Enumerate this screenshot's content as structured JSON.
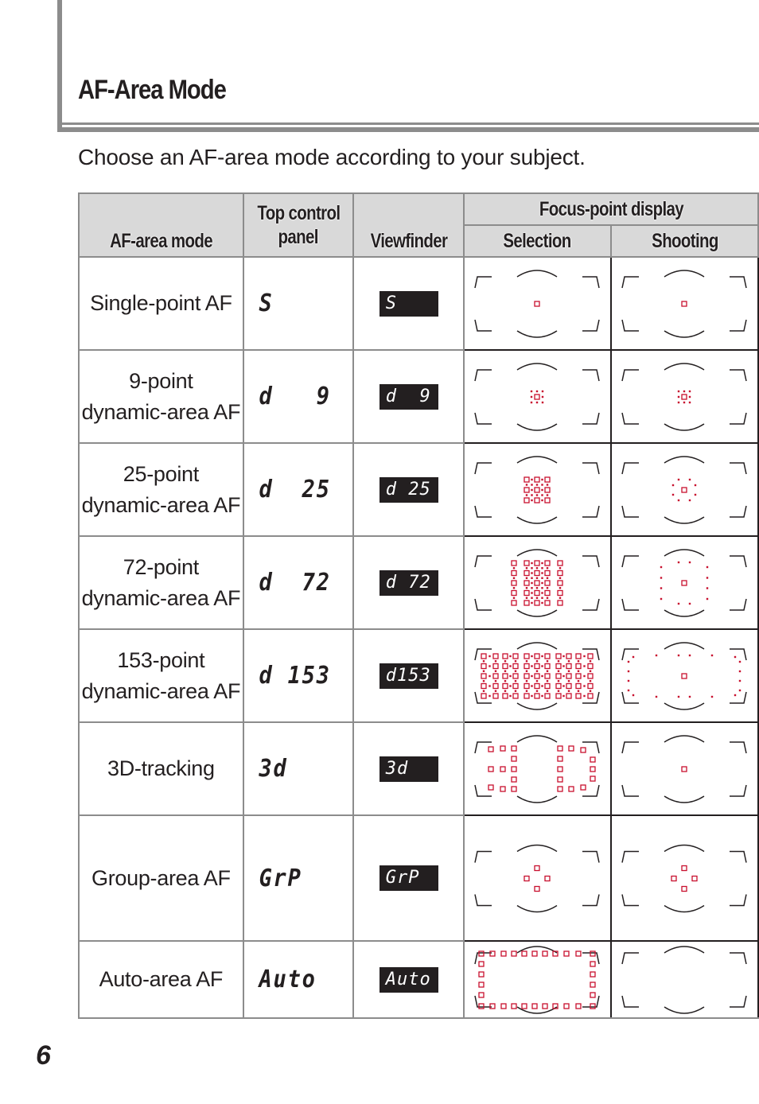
{
  "page": {
    "title": "AF-Area Mode",
    "intro": "Choose an AF-area mode according to your subject.",
    "page_number": "6"
  },
  "colors": {
    "focus_point": "#c8102e",
    "frame_line": "#231f20",
    "header_bg": "#d9d9d9",
    "rule": "#8c8c8c",
    "lcd_bg": "#231f20"
  },
  "table": {
    "headers": {
      "mode": "AF-area mode",
      "top_panel_line1": "Top control",
      "top_panel_line2": "panel",
      "viewfinder": "Viewfinder",
      "focus_group": "Focus-point display",
      "selection": "Selection",
      "shooting": "Shooting"
    },
    "rows": [
      {
        "mode_line1": "Single-point AF",
        "mode_line2": "",
        "top_panel": "S",
        "viewfinder": "S",
        "selection_pattern": "single",
        "shooting_pattern": "single"
      },
      {
        "mode_line1": "9-point",
        "mode_line2": "dynamic-area AF",
        "top_panel": "d   9",
        "viewfinder": "d  9",
        "selection_pattern": "d9",
        "shooting_pattern": "d9"
      },
      {
        "mode_line1": "25-point",
        "mode_line2": "dynamic-area AF",
        "top_panel": "d  25",
        "viewfinder": "d 25",
        "selection_pattern": "d25",
        "shooting_pattern": "d25-shoot"
      },
      {
        "mode_line1": "72-point",
        "mode_line2": "dynamic-area AF",
        "top_panel": "d  72",
        "viewfinder": "d 72",
        "selection_pattern": "d72",
        "shooting_pattern": "d72-shoot"
      },
      {
        "mode_line1": "153-point",
        "mode_line2": "dynamic-area AF",
        "top_panel": "d 153",
        "viewfinder": "d153",
        "selection_pattern": "d153",
        "shooting_pattern": "d153-shoot"
      },
      {
        "mode_line1": "3D-tracking",
        "mode_line2": "",
        "top_panel": "3d",
        "viewfinder": "3d",
        "selection_pattern": "3d",
        "shooting_pattern": "single"
      },
      {
        "mode_line1": "Group-area AF",
        "mode_line2": "",
        "top_panel": "GrP",
        "viewfinder": "GrP",
        "selection_pattern": "group",
        "shooting_pattern": "group"
      },
      {
        "mode_line1": "Auto-area AF",
        "mode_line2": "",
        "top_panel": "Auto",
        "viewfinder": "Auto",
        "selection_pattern": "auto",
        "shooting_pattern": "none"
      }
    ]
  }
}
